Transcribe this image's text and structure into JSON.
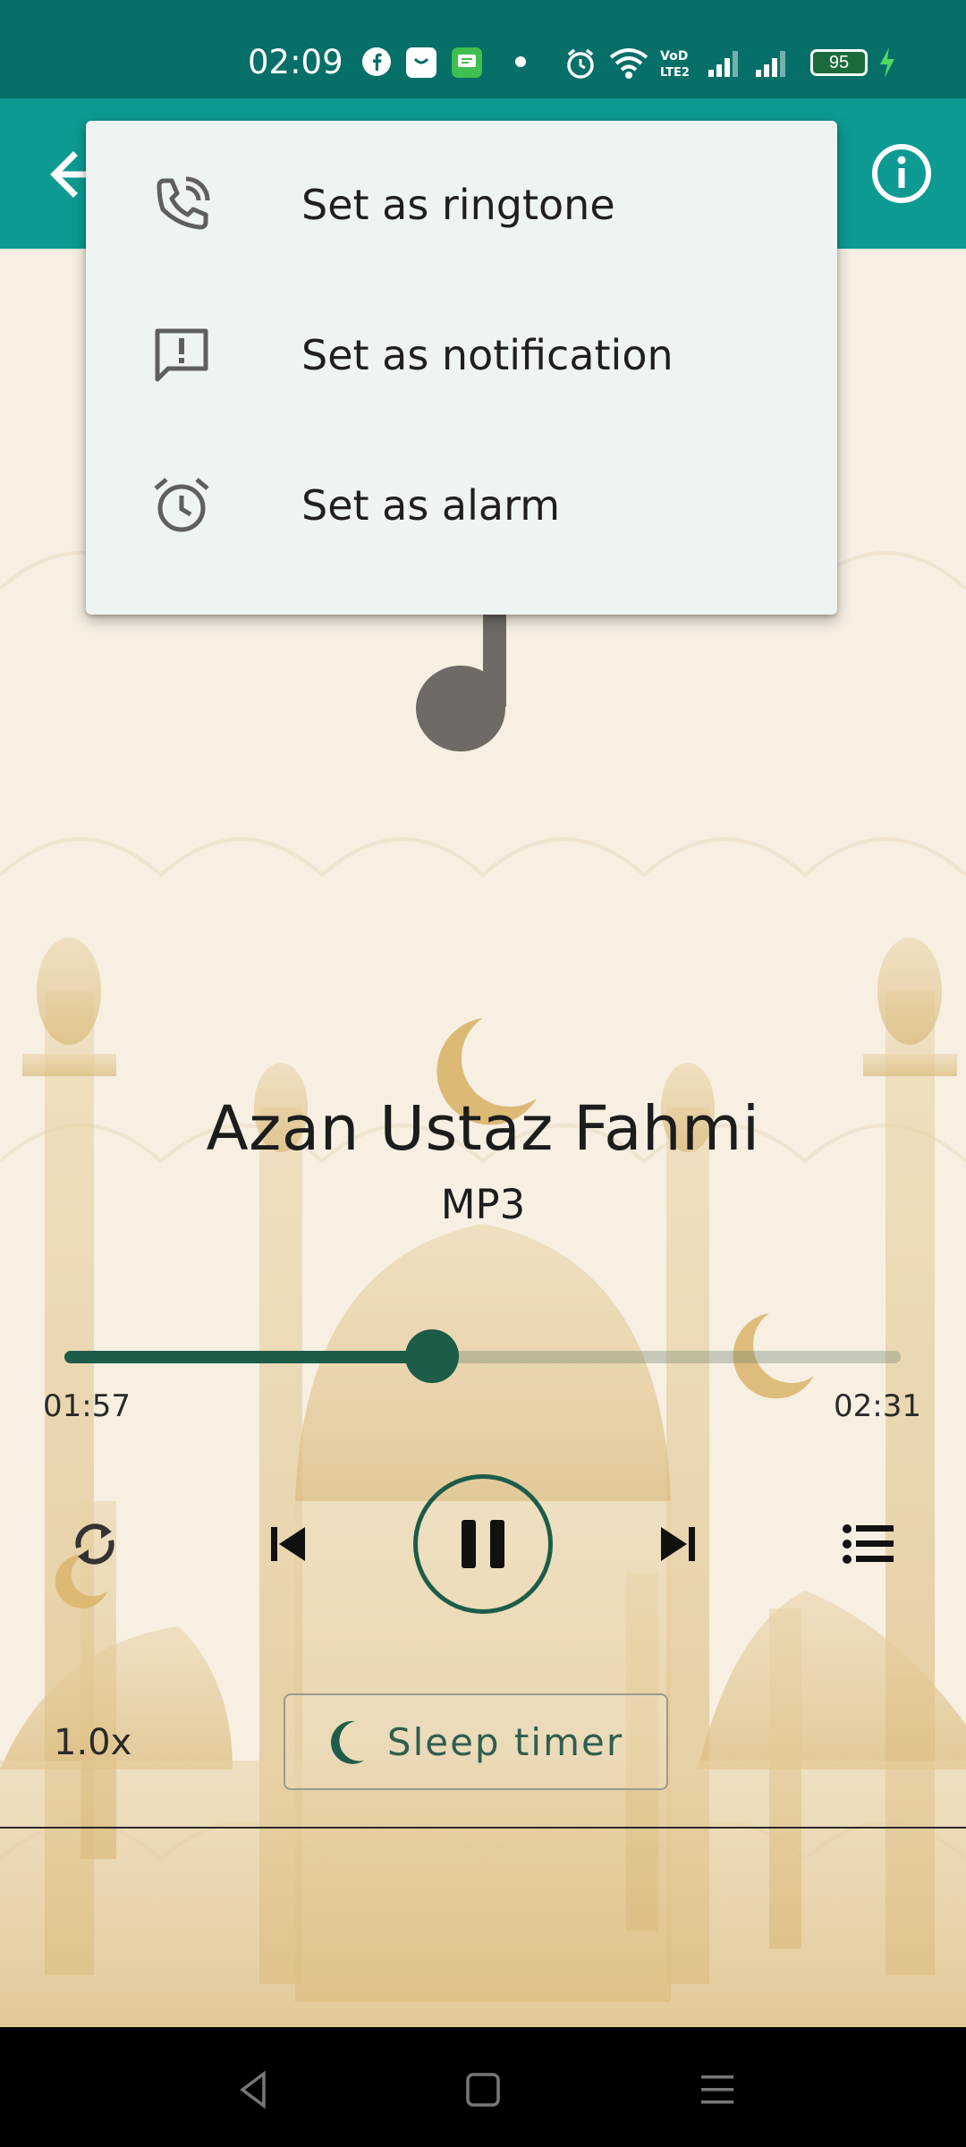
{
  "status_bar": {
    "time": "02:09",
    "battery": "95",
    "network_label": "VoLTE2",
    "icons": [
      "facebook-icon",
      "shopping-bag-icon",
      "messages-icon",
      "dot-icon",
      "alarm-icon",
      "wifi-icon",
      "volte-icon",
      "signal-icon",
      "signal-icon",
      "battery-icon",
      "charging-icon"
    ]
  },
  "app_bar": {
    "back_icon": "arrow-left-icon",
    "info_icon": "info-circle-icon",
    "background": "#0c9a92"
  },
  "menu": {
    "items": [
      {
        "label": "Set as ringtone",
        "icon": "phone-ringtone-icon"
      },
      {
        "label": "Set as notification",
        "icon": "notification-alert-icon"
      },
      {
        "label": "Set as alarm",
        "icon": "alarm-clock-icon"
      }
    ]
  },
  "track": {
    "title": "Azan Ustaz Fahmi",
    "format": "MP3",
    "current_time": "01:57",
    "total_time": "02:31",
    "progress_fraction": 0.44
  },
  "controls": {
    "repeat_icon": "repeat-icon",
    "previous_icon": "skip-previous-icon",
    "play_pause_icon": "pause-icon",
    "next_icon": "skip-next-icon",
    "playlist_icon": "playlist-icon"
  },
  "bottom": {
    "speed": "1.0x",
    "sleep_timer_label": "Sleep timer",
    "sleep_icon": "moon-icon"
  },
  "colors": {
    "accent": "#1e5c4a",
    "status_bar": "#056f68",
    "menu_bg": "#eef4f2",
    "page_bg": "#f6efe2"
  }
}
